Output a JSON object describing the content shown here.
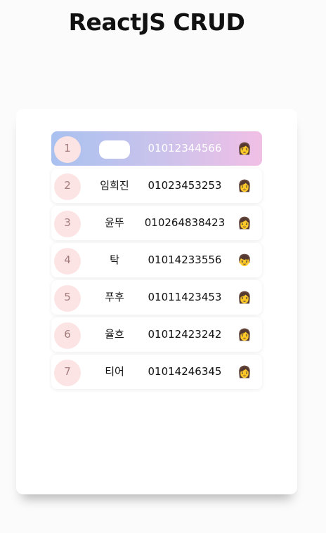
{
  "header": {
    "title": "ReactJS CRUD"
  },
  "contacts": [
    {
      "id": "1",
      "name": "",
      "phone": "01012344566",
      "avatar": "👩",
      "selected": true
    },
    {
      "id": "2",
      "name": "임희진",
      "phone": "01023453253",
      "avatar": "👩"
    },
    {
      "id": "3",
      "name": "윤뚜",
      "phone": "010264838423",
      "avatar": "👩"
    },
    {
      "id": "4",
      "name": "탁",
      "phone": "01014233556",
      "avatar": "👦"
    },
    {
      "id": "5",
      "name": "푸후",
      "phone": "01011423453",
      "avatar": "👩"
    },
    {
      "id": "6",
      "name": "율흐",
      "phone": "01012423242",
      "avatar": "👩"
    },
    {
      "id": "7",
      "name": "티어",
      "phone": "01014246345",
      "avatar": "👩"
    }
  ]
}
